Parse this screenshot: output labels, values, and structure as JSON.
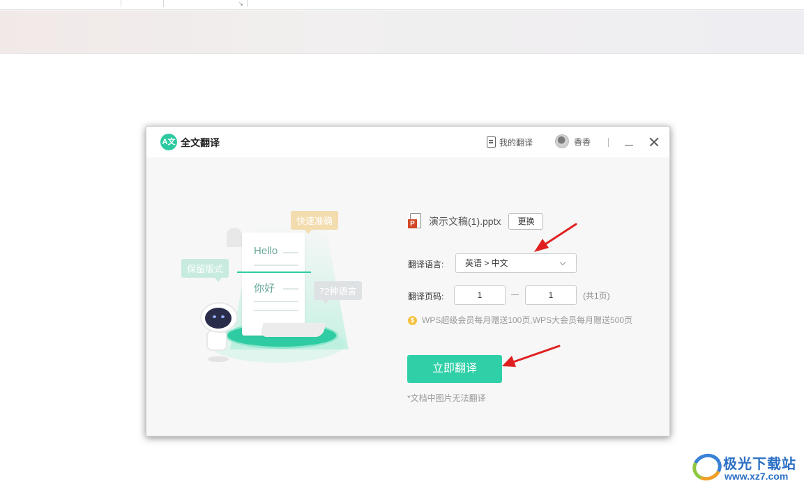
{
  "dialog": {
    "title": "全文翻译",
    "logo_text": "A文",
    "my_translations": "我的翻译",
    "user_name": "香香"
  },
  "illustration": {
    "bubble_fast": "快速准确",
    "bubble_format": "保留版式",
    "bubble_languages": "72种语言",
    "hello": "Hello",
    "nihao": "你好"
  },
  "file": {
    "icon_letter": "P",
    "name": "演示文稿(1).pptx",
    "change_label": "更换"
  },
  "language": {
    "label": "翻译语言:",
    "value": "英语 > 中文"
  },
  "pages": {
    "label": "翻译页码:",
    "from": "1",
    "to": "1",
    "total": "(共1页)"
  },
  "promo": {
    "coin": "$",
    "text": "WPS超级会员每月赠送100页,WPS大会员每月赠送500页"
  },
  "translate_button": "立即翻译",
  "note": "*文档中图片无法翻译",
  "watermark": {
    "brand": "极光下载站",
    "url": "www.xz7.com"
  },
  "colors": {
    "accent": "#2fcfa7",
    "annotation_arrow": "#e02020",
    "ppt": "#d24726"
  }
}
